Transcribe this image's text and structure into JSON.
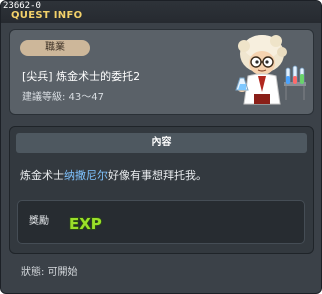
{
  "window": {
    "quest_id": "23662-0",
    "title": "QUEST INFO"
  },
  "quest": {
    "job_label": "職業",
    "name": "[尖兵] 炼金术士的委托2",
    "level_text": "建議等級: 43～47",
    "npc_icon": "alchemist-npc-portrait"
  },
  "content": {
    "header": "內容",
    "text_before": "炼金术士",
    "npc_name": "纳撒尼尔",
    "text_after": "好像有事想拜托我。"
  },
  "reward": {
    "label": "獎勵",
    "icon_text": "EXP"
  },
  "status": {
    "text": "狀態: 可開始"
  },
  "colors": {
    "title": "#f3d16a",
    "npc_name": "#7fc3ff",
    "exp": "#9be02a"
  }
}
